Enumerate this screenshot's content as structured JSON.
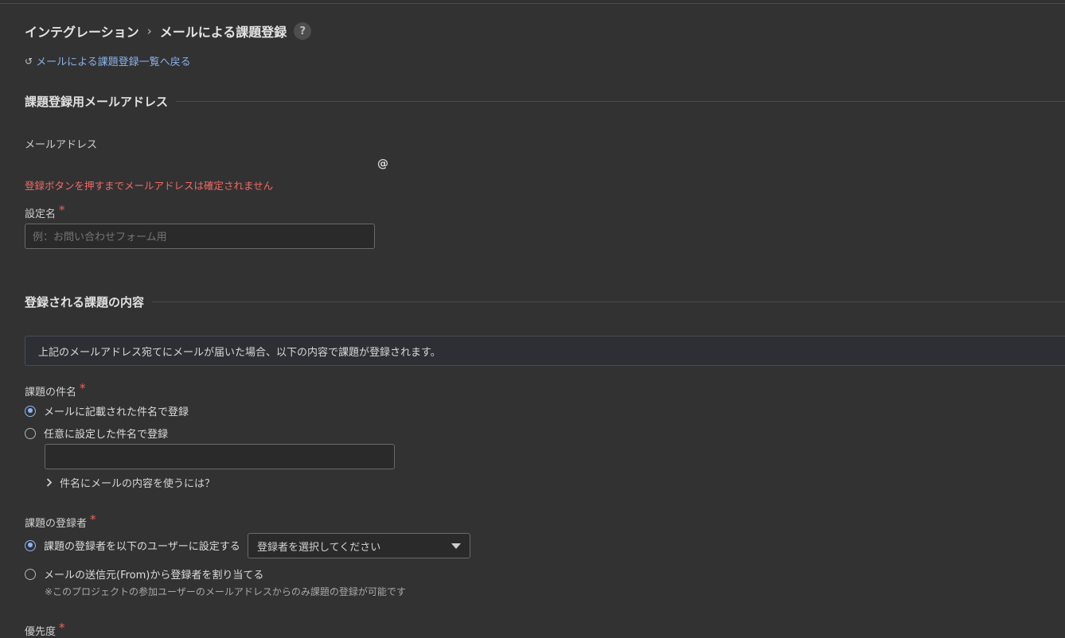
{
  "breadcrumb": {
    "parent": "インテグレーション",
    "separator": "›",
    "current": "メールによる課題登録",
    "help": "?"
  },
  "back_link": {
    "arrow": "↺",
    "label": "メールによる課題登録一覧へ戻る"
  },
  "section_email": {
    "title": "課題登録用メールアドレス",
    "email_label": "メールアドレス",
    "at_sign": "@",
    "warning": "登録ボタンを押すまでメールアドレスは確定されません"
  },
  "setting_name": {
    "label": "設定名",
    "required": "*",
    "placeholder": "例：お問い合わせフォーム用",
    "value": ""
  },
  "section_issue": {
    "title": "登録される課題の内容",
    "info": "上記のメールアドレス宛てにメールが届いた場合、以下の内容で課題が登録されます。"
  },
  "subject": {
    "label": "課題の件名",
    "required": "*",
    "options": [
      {
        "label": "メールに記載された件名で登録",
        "selected": true
      },
      {
        "label": "任意に設定した件名で登録",
        "selected": false
      }
    ],
    "custom_value": "",
    "expander": "件名にメールの内容を使うには？"
  },
  "registrant": {
    "label": "課題の登録者",
    "required": "*",
    "options": [
      {
        "label": "課題の登録者を以下のユーザーに設定する",
        "selected": true
      },
      {
        "label": "メールの送信元(From)から登録者を割り当てる",
        "selected": false
      }
    ],
    "select_placeholder": "登録者を選択してください",
    "note": "※このプロジェクトの参加ユーザーのメールアドレスからのみ課題の登録が可能です"
  },
  "priority": {
    "label": "優先度",
    "required": "*"
  },
  "colors": {
    "accent": "#8fb3f5",
    "link": "#8ab0e8",
    "warning": "#ef6b68",
    "background": "#323232"
  }
}
